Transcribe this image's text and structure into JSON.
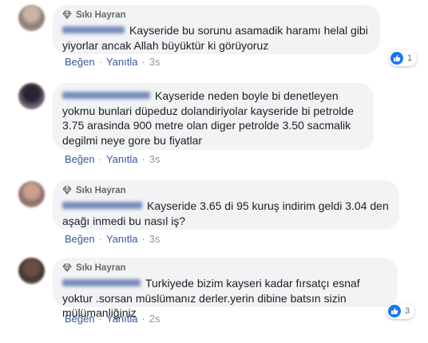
{
  "comments": [
    {
      "badge": "Sıkı Hayran",
      "text": "Kayseride bu sorunu asamadik haramı helal gibi yiyorlar ancak Allah büyüktür ki görüyoruz",
      "like": "Beğen",
      "reply": "Yanıtla",
      "time": "3s",
      "reactions": "1"
    },
    {
      "badge": "",
      "text": "Kayseride neden boyle bi denetleyen yokmu bunlari düpeduz dolandiriyolar kayseride bi petrolde 3.75 arasinda 900 metre olan diger petrolde 3.50 sacmalik degilmi neye gore bu fiyatlar",
      "like": "Beğen",
      "reply": "Yanıtla",
      "time": "3s"
    },
    {
      "badge": "Sıkı Hayran",
      "text": "Kayseride 3.65 di 95 kuruş indirim geldi 3.04 den aşağı inmedi bu nasıl iş?",
      "like": "Beğen",
      "reply": "Yanıtla",
      "time": "3s"
    },
    {
      "badge": "Sıkı Hayran",
      "text": "Turkiyede bizim kayseri kadar fırsatçı esnaf yoktur .sorsan müslümanız derler.yerin dibine batsın sizin mülümanliğiniz",
      "like": "Beğen",
      "reply": "Yanıtla",
      "time": "2s",
      "reactions": "3"
    }
  ],
  "icons": {
    "badge": "diamond-icon",
    "reaction": "thumbs-up-icon"
  },
  "colors": {
    "link": "#385898",
    "bubble": "#f2f3f5",
    "like_blue": "#1877f2"
  }
}
